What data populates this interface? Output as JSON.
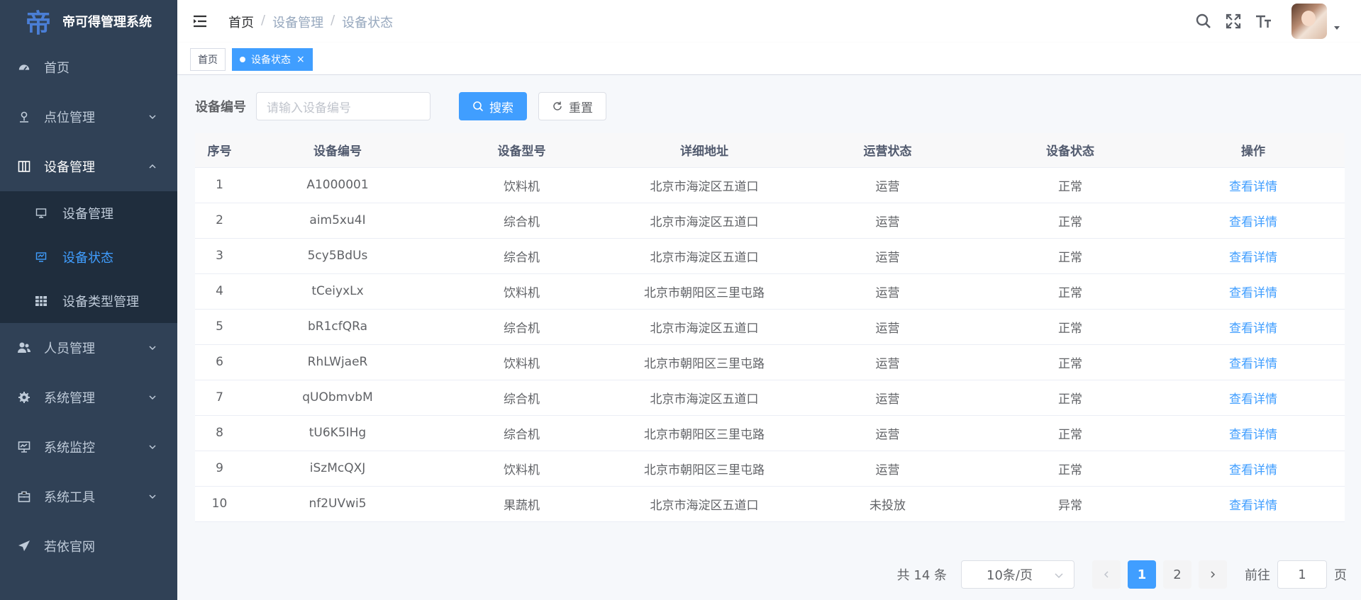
{
  "app": {
    "title": "帝可得管理系统",
    "logo_char": "帝"
  },
  "sidebar": {
    "items": [
      {
        "label": "首页",
        "icon": "dashboard-icon"
      },
      {
        "label": "点位管理",
        "icon": "location-icon"
      },
      {
        "label": "设备管理",
        "icon": "device-icon"
      },
      {
        "label": "人员管理",
        "icon": "peoples-icon"
      },
      {
        "label": "系统管理",
        "icon": "system-icon"
      },
      {
        "label": "系统监控",
        "icon": "monitor-icon"
      },
      {
        "label": "系统工具",
        "icon": "tool-icon"
      },
      {
        "label": "若依官网",
        "icon": "guide-icon"
      }
    ],
    "submenu": [
      {
        "label": "设备管理",
        "icon": "monitor-small-icon"
      },
      {
        "label": "设备状态",
        "icon": "chart-monitor-icon"
      },
      {
        "label": "设备类型管理",
        "icon": "grid-icon"
      }
    ]
  },
  "breadcrumb": [
    "首页",
    "设备管理",
    "设备状态"
  ],
  "tags": [
    {
      "label": "首页"
    },
    {
      "label": "设备状态",
      "close": "×"
    }
  ],
  "search": {
    "label": "设备编号",
    "placeholder": "请输入设备编号",
    "search_button": "搜索",
    "reset_button": "重置"
  },
  "table": {
    "headers": [
      "序号",
      "设备编号",
      "设备型号",
      "详细地址",
      "运营状态",
      "设备状态",
      "操作"
    ],
    "rows": [
      [
        "1",
        "A1000001",
        "饮料机",
        "北京市海淀区五道口",
        "运营",
        "正常",
        "查看详情"
      ],
      [
        "2",
        "aim5xu4I",
        "综合机",
        "北京市海淀区五道口",
        "运营",
        "正常",
        "查看详情"
      ],
      [
        "3",
        "5cy5BdUs",
        "综合机",
        "北京市海淀区五道口",
        "运营",
        "正常",
        "查看详情"
      ],
      [
        "4",
        "tCeiyxLx",
        "饮料机",
        "北京市朝阳区三里屯路",
        "运营",
        "正常",
        "查看详情"
      ],
      [
        "5",
        "bR1cfQRa",
        "综合机",
        "北京市海淀区五道口",
        "运营",
        "正常",
        "查看详情"
      ],
      [
        "6",
        "RhLWjaeR",
        "饮料机",
        "北京市朝阳区三里屯路",
        "运营",
        "正常",
        "查看详情"
      ],
      [
        "7",
        "qUObmvbM",
        "综合机",
        "北京市海淀区五道口",
        "运营",
        "正常",
        "查看详情"
      ],
      [
        "8",
        "tU6K5IHg",
        "综合机",
        "北京市朝阳区三里屯路",
        "运营",
        "正常",
        "查看详情"
      ],
      [
        "9",
        "iSzMcQXJ",
        "饮料机",
        "北京市朝阳区三里屯路",
        "运营",
        "正常",
        "查看详情"
      ],
      [
        "10",
        "nf2UVwi5",
        "果蔬机",
        "北京市海淀区五道口",
        "未投放",
        "异常",
        "查看详情"
      ]
    ]
  },
  "pagination": {
    "total": "共 14 条",
    "page_size": "10条/页",
    "pages": [
      "1",
      "2"
    ],
    "goto_label": "前往",
    "goto_value": "1",
    "page_suffix": "页"
  },
  "colors": {
    "sidebar_bg": "#304156",
    "submenu_bg": "#1f2d3d",
    "accent": "#409eff"
  }
}
